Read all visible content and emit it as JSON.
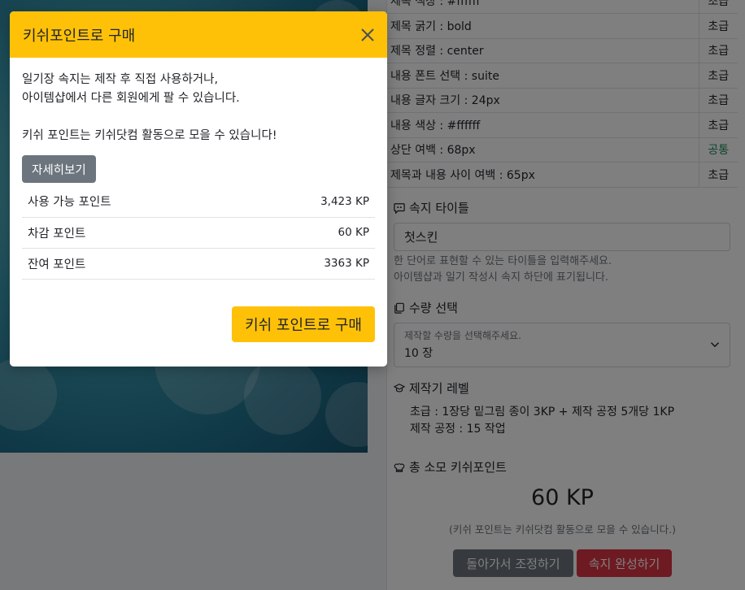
{
  "background": {
    "options": [
      {
        "label": "제목 색상 : #ffffff",
        "level": "초급",
        "level_color": "default"
      },
      {
        "label": "제목 굵기 : bold",
        "level": "초급",
        "level_color": "default"
      },
      {
        "label": "제목 정렬 : center",
        "level": "초급",
        "level_color": "default"
      },
      {
        "label": "내용 폰트 선택 : suite",
        "level": "초급",
        "level_color": "default"
      },
      {
        "label": "내용 글자 크기 : 24px",
        "level": "초급",
        "level_color": "default"
      },
      {
        "label": "내용 색상 : #ffffff",
        "level": "초급",
        "level_color": "default"
      },
      {
        "label": "상단 여백 : 68px",
        "level": "공통",
        "level_color": "#198754"
      },
      {
        "label": "제목과 내용 사이 여백 : 65px",
        "level": "초급",
        "level_color": "default"
      }
    ],
    "title_section": {
      "label": "속지 타이틀",
      "icon": "chat-quote-icon",
      "value": "첫스킨",
      "help1": "한 단어로 표현할 수 있는 타이틀을 입력해주세요.",
      "help2": "아이템샵과 일기 작성시 속지 하단에 표기됩니다."
    },
    "qty_section": {
      "label": "수량 선택",
      "icon": "copy-icon",
      "placeholder": "제작할 수량을 선택해주세요.",
      "value": "10 장"
    },
    "level_section": {
      "label": "제작기 레벨",
      "icon": "mortarboard-icon",
      "line1": "초급 : 1장당 밑그림 종이 3KP + 제작 공정 5개당 1KP",
      "line2": "제작 공정 : 15 작업"
    },
    "total_section": {
      "label": "총 소모 키쉬포인트",
      "icon": "chef-hat-icon",
      "value": "60 KP",
      "note": "(키쉬 포인트는 키쉬닷컴 활동으로 모을 수 있습니다.)"
    },
    "back_button": "돌아가서 조정하기",
    "done_button": "속지 완성하기"
  },
  "modal": {
    "title": "키쉬포인트로 구매",
    "desc1_line1": "일기장 속지는 제작 후 직접 사용하거나,",
    "desc1_line2": "아이템샵에서 다른 회원에게 팔 수 있습니다.",
    "desc2": "키쉬 포인트는 키쉬닷컴 활동으로 모을 수 있습니다!",
    "detail_button": "자세히보기",
    "points": [
      {
        "label": "사용 가능 포인트",
        "value": "3,423 KP"
      },
      {
        "label": "차감 포인트",
        "value": "60 KP"
      },
      {
        "label": "잔여 포인트",
        "value": "3363 KP"
      }
    ],
    "buy_button": "키쉬 포인트로 구매"
  },
  "colors": {
    "accent": "#ffc107",
    "secondary": "#6c757d",
    "danger": "#dc3545",
    "success": "#198754"
  }
}
